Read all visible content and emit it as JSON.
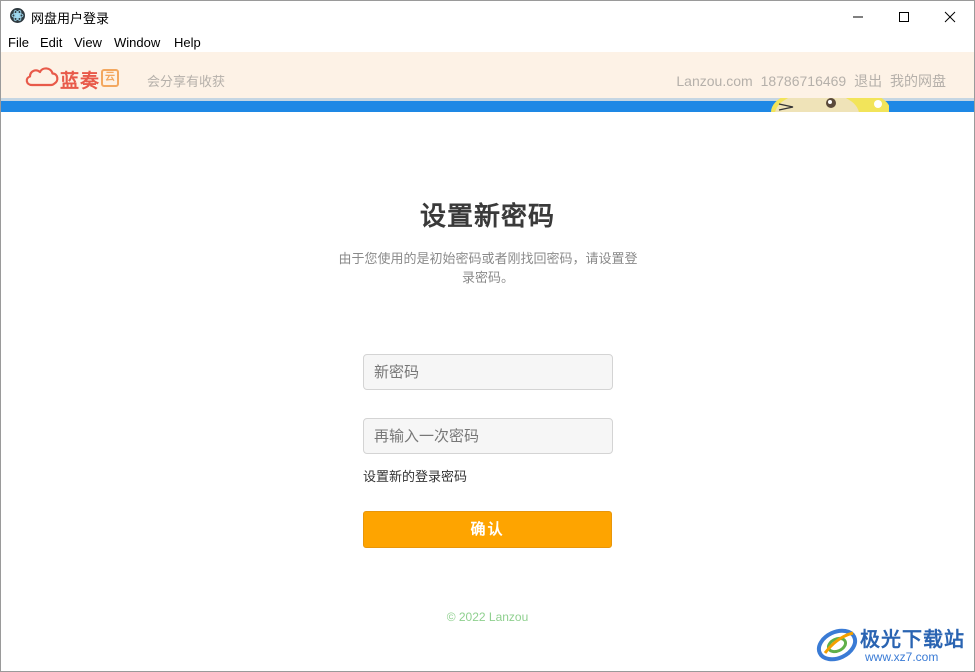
{
  "window": {
    "title": "网盘用户登录"
  },
  "menu": {
    "items": [
      "File",
      "Edit",
      "View",
      "Window",
      "Help"
    ]
  },
  "header": {
    "logo_text": "蓝奏",
    "logo_badge": "云",
    "slogan": "会分享有收获",
    "site": "Lanzou.com",
    "phone": "18786716469",
    "logout": "退出",
    "my_disk": "我的网盘"
  },
  "main": {
    "title": "设置新密码",
    "description": "由于您使用的是初始密码或者刚找回密码，请设置登录密码。",
    "new_password_placeholder": "新密码",
    "repeat_password_placeholder": "再输入一次密码",
    "hint": "设置新的登录密码",
    "confirm_label": "确认"
  },
  "footer": {
    "text": "© 2022 Lanzou"
  },
  "watermark": {
    "name": "极光下载站",
    "url": "www.xz7.com"
  },
  "colors": {
    "accent": "#fea400",
    "header_bg": "#fdf2e6",
    "banner": "#1e88e5",
    "logo": "#e85a4a"
  }
}
